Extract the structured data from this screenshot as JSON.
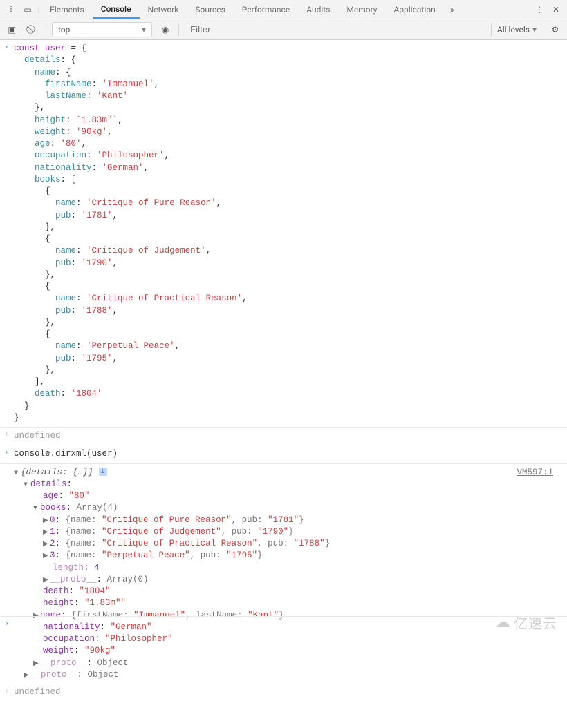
{
  "tabs": {
    "items": [
      "Elements",
      "Console",
      "Network",
      "Sources",
      "Performance",
      "Audits",
      "Memory",
      "Application"
    ],
    "active": "Console"
  },
  "toolbar": {
    "scope": "top",
    "filter_placeholder": "Filter",
    "levels": "All levels"
  },
  "input1": {
    "declare": "const user",
    "eq": " = ",
    "open": "{",
    "details_label": "details",
    "name_label": "name",
    "firstName_label": "firstName",
    "firstName_val": "'Immanuel'",
    "lastName_label": "lastName",
    "lastName_val": "'Kant'",
    "height_label": "height",
    "height_val": "`1.83m\"`",
    "weight_label": "weight",
    "weight_val": "'90kg'",
    "age_label": "age",
    "age_val": "'80'",
    "occupation_label": "occupation",
    "occupation_val": "'Philosopher'",
    "nationality_label": "nationality",
    "nationality_val": "'German'",
    "books_label": "books",
    "book1_name": "'Critique of Pure Reason'",
    "book1_pub": "'1781'",
    "book2_name": "'Critique of Judgement'",
    "book2_pub": "'1790'",
    "book3_name": "'Critique of Practical Reason'",
    "book3_pub": "'1788'",
    "book4_name": "'Perpetual Peace'",
    "book4_pub": "'1795'",
    "pub_label": "pub",
    "death_label": "death",
    "death_val": "'1804'"
  },
  "result1": "undefined",
  "input2": "console.dirxml(user)",
  "tree": {
    "summary": "{details: {…}}",
    "details_label": "details",
    "age_label": "age",
    "age_val": "\"80\"",
    "books_label": "books",
    "books_type": "Array(4)",
    "rows": [
      {
        "idx": "0",
        "name": "\"Critique of Pure Reason\"",
        "pub": "\"1781\""
      },
      {
        "idx": "1",
        "name": "\"Critique of Judgement\"",
        "pub": "\"1790\""
      },
      {
        "idx": "2",
        "name": "\"Critique of Practical Reason\"",
        "pub": "\"1788\""
      },
      {
        "idx": "3",
        "name": "\"Perpetual Peace\"",
        "pub": "\"1795\""
      }
    ],
    "length_label": "length",
    "length_val": "4",
    "proto_label": "__proto__",
    "proto_arr": "Array(0)",
    "proto_obj": "Object",
    "death_label": "death",
    "death_val": "\"1804\"",
    "height_label": "height",
    "height_val": "\"1.83m\"\"",
    "name_label": "name",
    "name_summary_fn": "firstName",
    "name_summary_fv": "\"Immanuel\"",
    "name_summary_ln": "lastName",
    "name_summary_lv": "\"Kant\"",
    "nationality_label": "nationality",
    "nationality_val": "\"German\"",
    "occupation_label": "occupation",
    "occupation_val": "\"Philosopher\"",
    "weight_label": "weight",
    "weight_val": "\"90kg\""
  },
  "source_link": "VM597:1",
  "result2": "undefined",
  "watermark": "亿速云"
}
